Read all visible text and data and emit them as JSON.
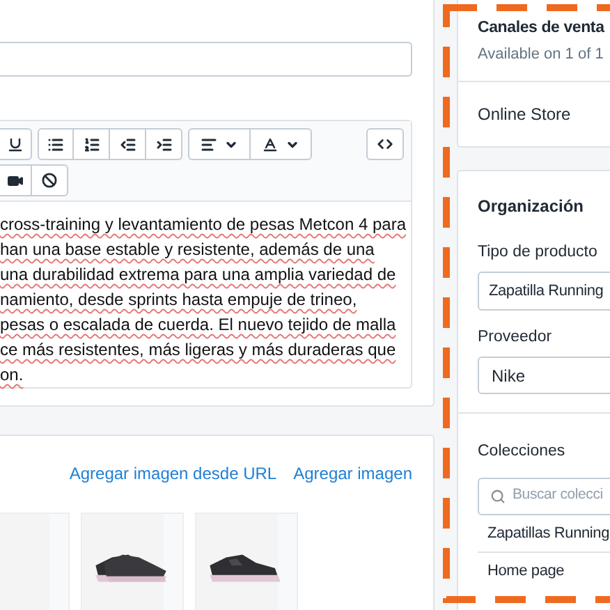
{
  "editor": {
    "description_lines": [
      "cross-training y levantamiento de pesas Metcon 4 para",
      "han una base estable y resistente, además de una",
      "una durabilidad extrema para una amplia variedad de",
      "namiento, desde sprints hasta empuje de trineo,",
      "pesas o escalada de cuerda. El nuevo tejido de malla",
      "ce más resistentes, más ligeras y más duraderas que",
      "on."
    ]
  },
  "media": {
    "links": [
      "Agregar imagen desde URL",
      "Agregar imagen"
    ],
    "images": [
      {
        "kind": "picture"
      },
      {
        "kind": "picture"
      },
      {
        "kind": "picture"
      }
    ]
  },
  "sales_channels": {
    "title": "Canales de venta",
    "subtitle": "Available on 1 of 1",
    "channels": [
      "Online Store"
    ]
  },
  "organization": {
    "title": "Organización",
    "product_type": {
      "label": "Tipo de producto",
      "value": "Zapatilla Running"
    },
    "vendor": {
      "label": "Proveedor",
      "value": "Nike"
    },
    "collections": {
      "label": "Colecciones",
      "placeholder": "Buscar colecci",
      "items": [
        "Zapatillas Running",
        "Home page"
      ]
    }
  }
}
